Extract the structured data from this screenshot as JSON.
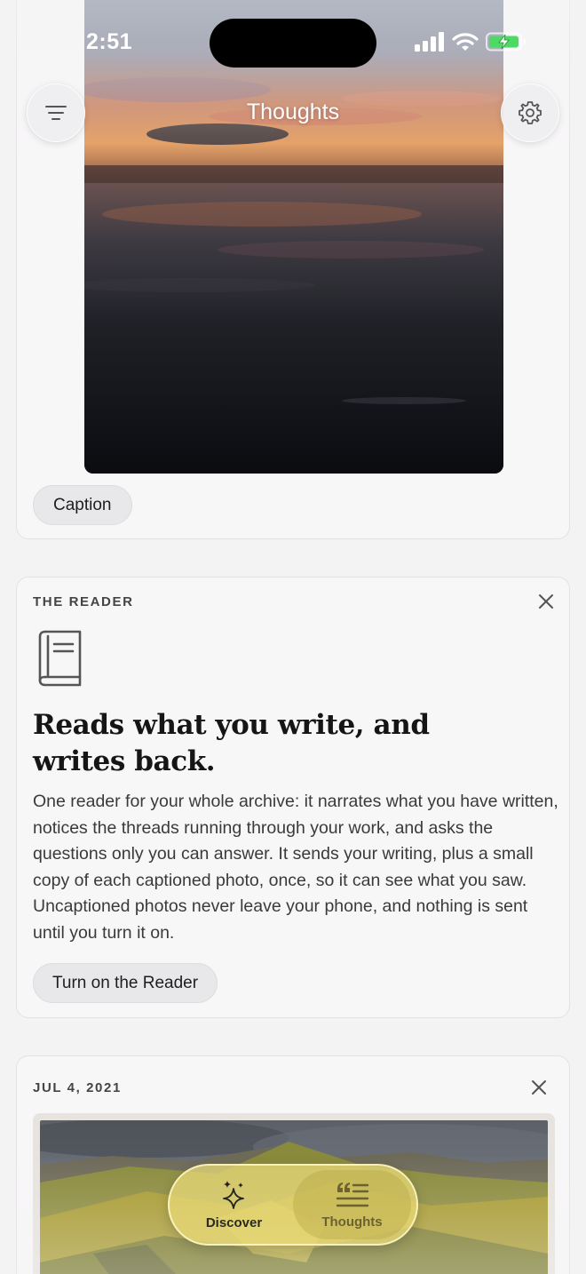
{
  "status_bar": {
    "time": "2:51"
  },
  "header": {
    "title": "Thoughts"
  },
  "photo_card": {
    "caption_button": "Caption"
  },
  "reader_card": {
    "eyebrow": "THE READER",
    "heading": "Reads what you write, and writes back.",
    "body": "One reader for your whole archive: it narrates what you have written, notices the threads running through your work, and asks the questions only you can answer. It sends your writing, plus a small copy of each captioned photo, once, so it can see what you saw. Uncaptioned photos never leave your phone, and nothing is sent until you turn it on.",
    "button": "Turn on the Reader"
  },
  "memory_card": {
    "date": "JUL 4, 2021"
  },
  "tab_bar": {
    "tabs": [
      {
        "label": "Discover",
        "icon": "sparkles-icon"
      },
      {
        "label": "Thoughts",
        "icon": "quote-lines-icon"
      }
    ],
    "active": "Thoughts"
  },
  "colors": {
    "background": "#f4f3f4",
    "tab_bar": "#ecdc78",
    "text": "#1a1a1a"
  }
}
